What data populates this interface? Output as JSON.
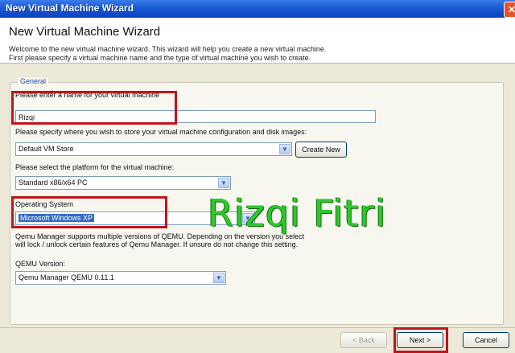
{
  "window": {
    "title": "New Virtual Machine Wizard",
    "close_glyph": "✕"
  },
  "header": {
    "title": "New Virtual Machine Wizard",
    "desc_line1": "Welcome to the new virtual machine wizard.  This wizard will help you create a new virtual machine.",
    "desc_line2": "First please specify a virtual machine name and the type of virtual machine you wish to create."
  },
  "group": {
    "label": "General"
  },
  "name": {
    "label": "Please enter a name for your virtual machine",
    "value": "Rizqi"
  },
  "store": {
    "label": "Please specify where you wish to store your virtual machine configuration and disk images:",
    "value": "Default VM Store",
    "create_new_label": "Create New"
  },
  "platform": {
    "label": "Please select the platform for the virtual machine:",
    "value": "Standard x86/x64 PC"
  },
  "os": {
    "label": "Operating System",
    "value": "Microsoft Windows XP"
  },
  "qemu_note": {
    "line1": "Qemu Manager supports multiple versions of QEMU. Depending on the version you select",
    "line2": "will lock / unlock certain features of Qemu Manager.  If unsure do not change this setting."
  },
  "qemu_version": {
    "label": "QEMU Version:",
    "value": "Qemu Manager QEMU 0.11.1"
  },
  "buttons": {
    "back": "< Back",
    "next": "Next >",
    "cancel": "Cancel"
  },
  "watermark": "Rizqi Fitri",
  "colors": {
    "highlight": "#c0141c",
    "watermark": "#2ec82a",
    "titlebar": "#1d5fd6"
  }
}
